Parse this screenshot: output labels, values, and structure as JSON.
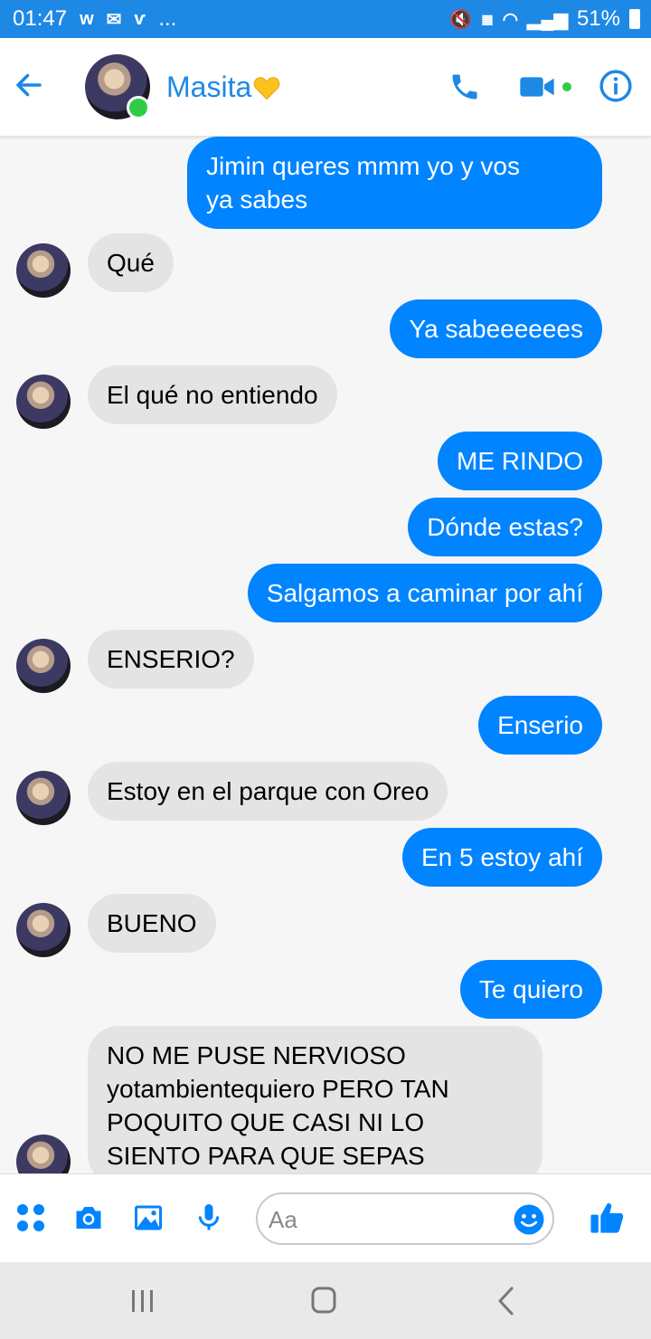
{
  "status_bar": {
    "time": "01:47",
    "dots": "...",
    "battery": "51%"
  },
  "header": {
    "contact_name": "Masita"
  },
  "messages": [
    {
      "dir": "out",
      "text": "Jimin queres mmm yo y vos\nya sabes"
    },
    {
      "dir": "in",
      "text": "Qué"
    },
    {
      "dir": "out",
      "text": "Ya sabeeeeees"
    },
    {
      "dir": "in",
      "text": "El qué no entiendo"
    },
    {
      "dir": "out",
      "text": "ME RINDO"
    },
    {
      "dir": "out",
      "text": "Dónde estas?"
    },
    {
      "dir": "out",
      "text": "Salgamos a caminar por ahí"
    },
    {
      "dir": "in",
      "text": "ENSERIO?"
    },
    {
      "dir": "out",
      "text": "Enserio"
    },
    {
      "dir": "in",
      "text": "Estoy en el parque con Oreo"
    },
    {
      "dir": "out",
      "text": "En 5 estoy ahí"
    },
    {
      "dir": "in",
      "text": "BUENO"
    },
    {
      "dir": "out",
      "text": "Te quiero"
    },
    {
      "dir": "in",
      "text": "NO ME PUSE NERVIOSO\nyotambientequiero PERO TAN\nPOQUITO QUE CASI NI LO\nSIENTO PARA QUE SEPAS"
    }
  ],
  "composer": {
    "placeholder": "Aa"
  },
  "colors": {
    "accent": "#0084ff",
    "header_blue": "#1e88e5",
    "incoming_bubble": "#e4e4e4",
    "online": "#31cc46"
  }
}
